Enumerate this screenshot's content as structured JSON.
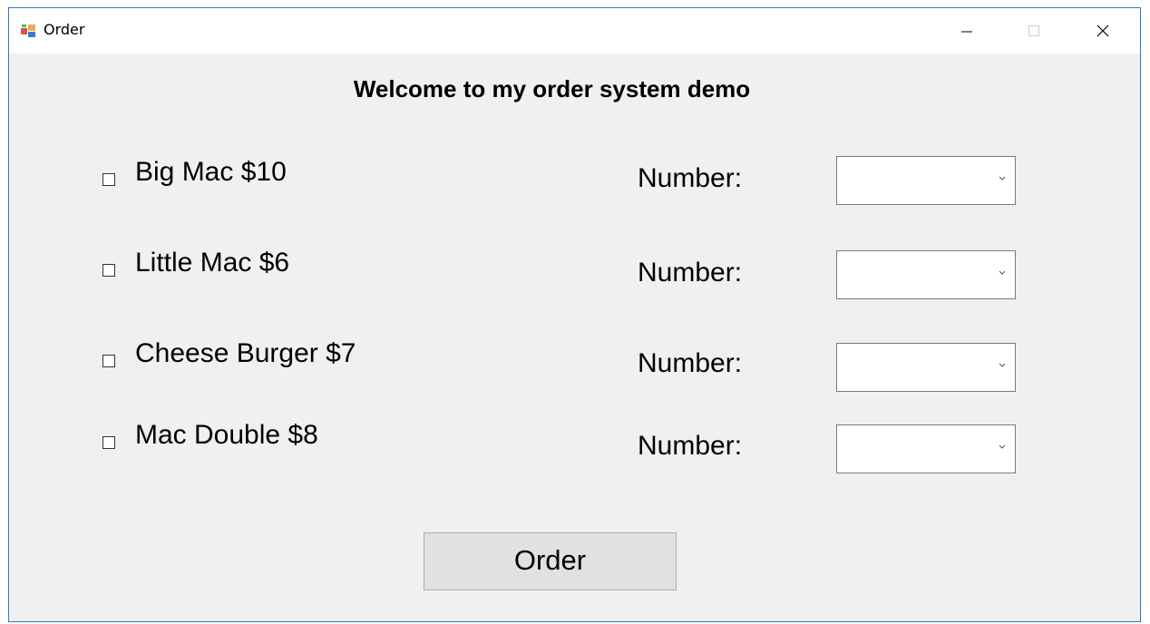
{
  "window": {
    "title": "Order",
    "icon": "form-app-icon",
    "controls": {
      "minimize_icon": "minimize-icon",
      "maximize_icon": "maximize-icon",
      "close_icon": "close-icon"
    }
  },
  "heading": "Welcome to my order system demo",
  "items": [
    {
      "label": "Big Mac $10",
      "checked": false,
      "number_label": "Number:",
      "quantity": ""
    },
    {
      "label": "Little Mac $6",
      "checked": false,
      "number_label": "Number:",
      "quantity": ""
    },
    {
      "label": "Cheese Burger $7",
      "checked": false,
      "number_label": "Number:",
      "quantity": ""
    },
    {
      "label": "Mac Double $8",
      "checked": false,
      "number_label": "Number:",
      "quantity": ""
    }
  ],
  "order_button": "Order",
  "colors": {
    "window_border": "#2b79c9",
    "client_background": "#f0f0f0",
    "button_background": "#e1e1e1"
  }
}
